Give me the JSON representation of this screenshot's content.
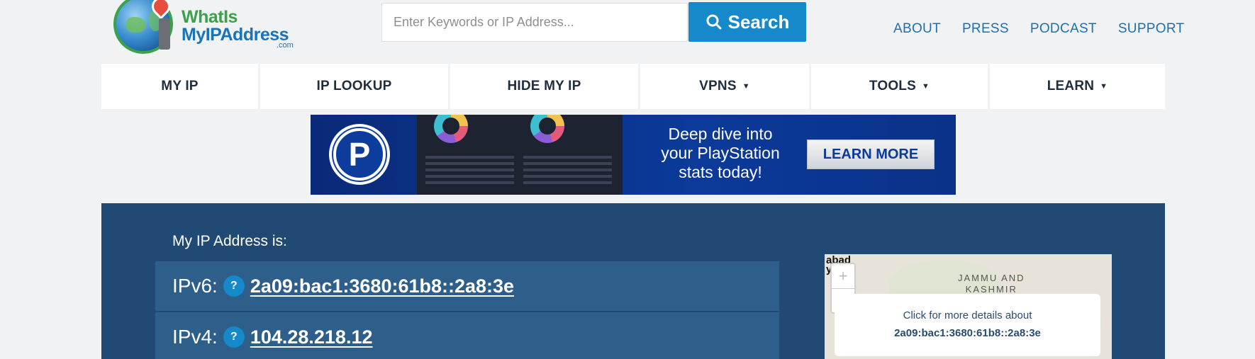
{
  "logo": {
    "line1": "WhatIs",
    "line2": "MyIPAddress",
    "suffix": ".com"
  },
  "search": {
    "placeholder": "Enter Keywords or IP Address...",
    "button_label": "Search"
  },
  "top_links": [
    "ABOUT",
    "PRESS",
    "PODCAST",
    "SUPPORT"
  ],
  "nav": {
    "items": [
      {
        "label": "MY IP",
        "dropdown": false
      },
      {
        "label": "IP LOOKUP",
        "dropdown": false
      },
      {
        "label": "HIDE MY IP",
        "dropdown": false
      },
      {
        "label": "VPNS",
        "dropdown": true
      },
      {
        "label": "TOOLS",
        "dropdown": true
      },
      {
        "label": "LEARN",
        "dropdown": true
      }
    ],
    "caret": "▼"
  },
  "ad": {
    "logo_letter": "P",
    "promo_line1": "Deep dive into",
    "promo_line2": "your PlayStation",
    "promo_line3": "stats today!",
    "cta": "LEARN MORE"
  },
  "ip": {
    "heading": "My IP Address is:",
    "help_glyph": "?",
    "ipv6_label": "IPv6:",
    "ipv6": "2a09:bac1:3680:61b8::2a8:3e",
    "ipv4_label": "IPv4:",
    "ipv4": "104.28.218.12"
  },
  "map": {
    "city_fragment": "abad",
    "city_fragment2": "y.",
    "region_line1": "JAMMU AND",
    "region_line2": "KASHMIR",
    "zoom_in": "+",
    "zoom_out": "−",
    "popup_line1": "Click for more details about",
    "popup_line2": "2a09:bac1:3680:61b8::2a8:3e"
  },
  "colors": {
    "accent": "#1589c9",
    "panel": "#204a74",
    "panel_row": "#2e5e8a",
    "link": "#1d6fae",
    "logo_green": "#3aa34a"
  }
}
